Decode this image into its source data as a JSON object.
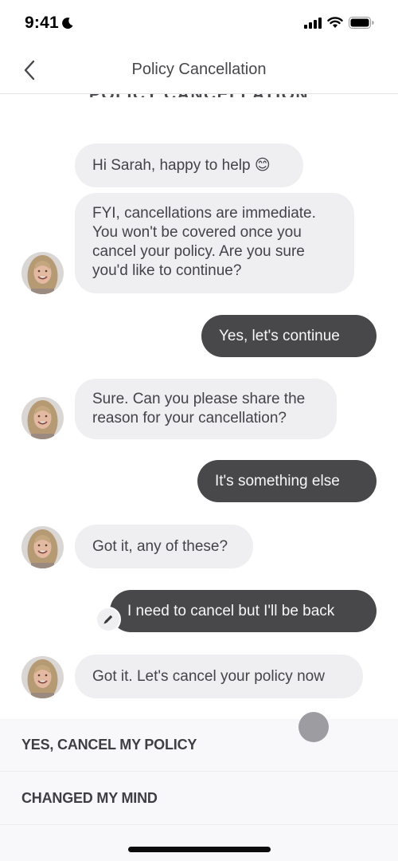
{
  "status_bar": {
    "time": "9:41",
    "icons": [
      "moon-icon",
      "cellular-signal-icon",
      "wifi-icon",
      "battery-icon"
    ]
  },
  "nav": {
    "back_icon": "chevron-left-icon",
    "title": "Policy Cancellation"
  },
  "scrolled_header": "POLICY CANCELLATION",
  "messages": [
    {
      "sender": "bot",
      "text": "Hi Sarah, happy to help 😊"
    },
    {
      "sender": "bot",
      "lines": [
        "FYI, cancellations are immediate.",
        "You won't be covered once you",
        "cancel your policy. Are you sure",
        "you'd like to continue?"
      ],
      "avatar": true
    },
    {
      "sender": "user",
      "text": "Yes, let's continue"
    },
    {
      "sender": "bot",
      "lines": [
        "Sure. Can you please share the",
        "reason for your cancellation?"
      ],
      "avatar": true
    },
    {
      "sender": "user",
      "text": "It's something else"
    },
    {
      "sender": "bot",
      "text": "Got it, any of these?",
      "avatar": true
    },
    {
      "sender": "user",
      "text": "I need to cancel but I'll be back",
      "editable": true,
      "edit_icon": "pencil-icon"
    },
    {
      "sender": "bot",
      "text": "Got it. Let's cancel your policy now",
      "avatar": true
    }
  ],
  "options": [
    {
      "label": "YES, CANCEL MY POLICY"
    },
    {
      "label": "CHANGED MY MIND"
    }
  ],
  "colors": {
    "bot_bubble": "#efeef1",
    "user_bubble": "#48474a",
    "options_bg": "#f8f7fa",
    "text_dark": "#3f3e42"
  }
}
